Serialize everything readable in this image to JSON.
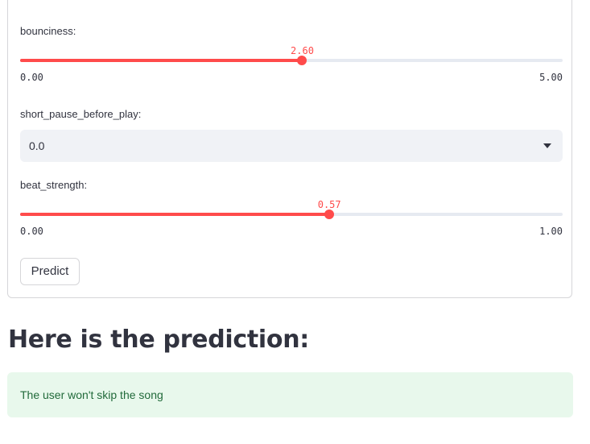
{
  "form": {
    "bounciness": {
      "label": "bounciness:",
      "value_text": "2.60",
      "min_text": "0.00",
      "max_text": "5.00",
      "fraction": 0.52
    },
    "short_pause_before_play": {
      "label": "short_pause_before_play:",
      "selected": "0.0"
    },
    "beat_strength": {
      "label": "beat_strength:",
      "value_text": "0.57",
      "min_text": "0.00",
      "max_text": "1.00",
      "fraction": 0.57
    },
    "predict_label": "Predict"
  },
  "result": {
    "heading": "Here is the prediction:",
    "message": "The user won't skip the song"
  },
  "colors": {
    "accent": "#ff4b4b",
    "success_bg": "#e8f8ec",
    "success_text": "#216a3a"
  }
}
